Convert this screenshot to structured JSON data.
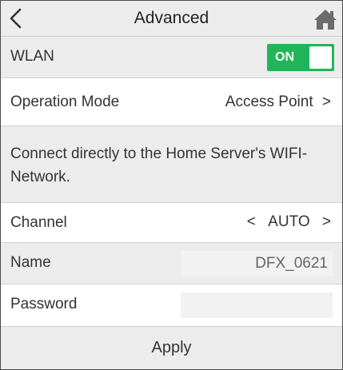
{
  "header": {
    "title": "Advanced",
    "back_icon": "chevron-left-icon",
    "home_icon": "home-icon"
  },
  "wlan": {
    "label": "WLAN",
    "toggle_text": "ON",
    "enabled": true,
    "toggle_color": "#21b55a"
  },
  "operation_mode": {
    "label": "Operation Mode",
    "value": "Access Point",
    "chevron": ">"
  },
  "description": "Connect directly to the Home Server's WIFI-Network.",
  "channel": {
    "label": "Channel",
    "prev": "<",
    "value": "AUTO",
    "next": ">"
  },
  "name": {
    "label": "Name",
    "value": "DFX_0621"
  },
  "password": {
    "label": "Password",
    "value": ""
  },
  "apply_label": "Apply"
}
